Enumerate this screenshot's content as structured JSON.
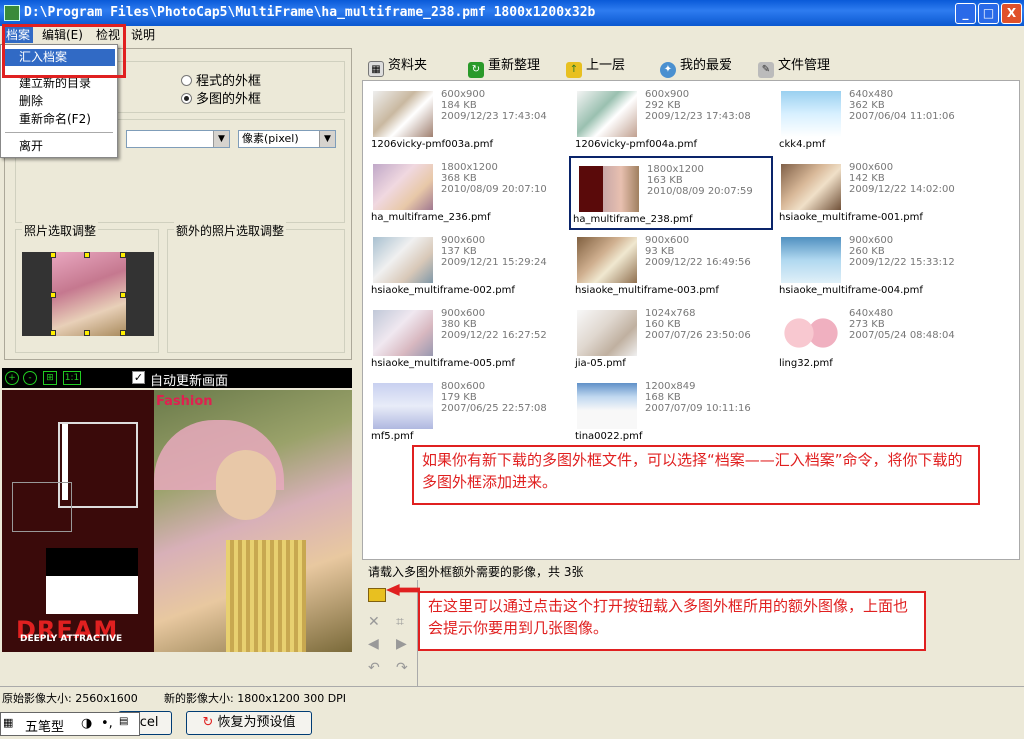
{
  "window": {
    "title": "D:\\Program Files\\PhotoCap5\\MultiFrame\\ha_multiframe_238.pmf    1800x1200x32b",
    "minimize": "_",
    "maximize": "□",
    "close": "X"
  },
  "menubar": {
    "items": [
      {
        "label": "档案"
      },
      {
        "label": "编辑(E)"
      },
      {
        "label": "检视"
      },
      {
        "label": "说明"
      }
    ]
  },
  "file_menu": {
    "items": [
      {
        "label": "汇入档案"
      },
      {
        "label": "建立新的目录"
      },
      {
        "label": "删除"
      },
      {
        "label": "重新命名(F2)"
      },
      {
        "label": "离开"
      }
    ]
  },
  "left_panel": {
    "radio_program_frame": "程式的外框",
    "radio_multi_frame": "多图的外框",
    "unit_select": "像素(pixel)",
    "photo_adjust_label": "照片选取调整",
    "extra_photo_adjust_label": "额外的照片选取调整"
  },
  "preview_toolbar": {
    "auto_update_label": "自动更新画面",
    "zoom_1to1": "1:1"
  },
  "preview": {
    "fashion_text": "Fashion",
    "dream_text": "DREAM",
    "deeply_text": "DEEPLY ATTRACTIVE"
  },
  "right_toolbar": {
    "folder_label": "资料夹",
    "refresh_label": "重新整理",
    "up_label": "上一层",
    "favorites_label": "我的最爱",
    "file_manage_label": "文件管理"
  },
  "files": [
    {
      "name": "1206vicky-pmf003a.pmf",
      "size": "600x900",
      "kb": "184 KB",
      "date": "2009/12/23 17:43:04",
      "selected": false
    },
    {
      "name": "1206vicky-pmf004a.pmf",
      "size": "600x900",
      "kb": "292 KB",
      "date": "2009/12/23 17:43:08",
      "selected": false
    },
    {
      "name": "ckk4.pmf",
      "size": "640x480",
      "kb": "362 KB",
      "date": "2007/06/04 11:01:06",
      "selected": false
    },
    {
      "name": "ha_multiframe_236.pmf",
      "size": "1800x1200",
      "kb": "368 KB",
      "date": "2010/08/09 20:07:10",
      "selected": false
    },
    {
      "name": "ha_multiframe_238.pmf",
      "size": "1800x1200",
      "kb": "163 KB",
      "date": "2010/08/09 20:07:59",
      "selected": true
    },
    {
      "name": "hsiaoke_multiframe-001.pmf",
      "size": "900x600",
      "kb": "142 KB",
      "date": "2009/12/22 14:02:00",
      "selected": false
    },
    {
      "name": "hsiaoke_multiframe-002.pmf",
      "size": "900x600",
      "kb": "137 KB",
      "date": "2009/12/21 15:29:24",
      "selected": false
    },
    {
      "name": "hsiaoke_multiframe-003.pmf",
      "size": "900x600",
      "kb": "93 KB",
      "date": "2009/12/22 16:49:56",
      "selected": false
    },
    {
      "name": "hsiaoke_multiframe-004.pmf",
      "size": "900x600",
      "kb": "260 KB",
      "date": "2009/12/22 15:33:12",
      "selected": false
    },
    {
      "name": "hsiaoke_multiframe-005.pmf",
      "size": "900x600",
      "kb": "380 KB",
      "date": "2009/12/22 16:27:52",
      "selected": false
    },
    {
      "name": "jia-05.pmf",
      "size": "1024x768",
      "kb": "160 KB",
      "date": "2007/07/26 23:50:06",
      "selected": false
    },
    {
      "name": "ling32.pmf",
      "size": "640x480",
      "kb": "273 KB",
      "date": "2007/05/24 08:48:04",
      "selected": false
    },
    {
      "name": "mf5.pmf",
      "size": "800x600",
      "kb": "179 KB",
      "date": "2007/06/25 22:57:08",
      "selected": false
    },
    {
      "name": "tina0022.pmf",
      "size": "1200x849",
      "kb": "168 KB",
      "date": "2007/07/09 10:11:16",
      "selected": false
    }
  ],
  "callouts": {
    "top": "如果你有新下载的多图外框文件，可以选择“档案——汇入档案”命令，将你下载的多图外框添加进来。",
    "bottom": "在这里可以通过点击这个打开按钮载入多图外框所用的额外图像，上面也会提示你要用到几张图像。"
  },
  "extra_panel": {
    "prompt": "请载入多图外框额外需要的影像，共 3张"
  },
  "statusbar": {
    "original_size": "原始影像大小: 2560x1600",
    "new_size": "新的影像大小: 1800x1200 300 DPI"
  },
  "bottombar": {
    "cancel_label": "ncel",
    "reset_label": "恢复为预设值"
  },
  "ime": {
    "label": "五笔型"
  },
  "colors": {
    "accent_red": "#e02020",
    "selection_blue": "#316ac5",
    "titlebar_blue": "#0a5ad8"
  }
}
